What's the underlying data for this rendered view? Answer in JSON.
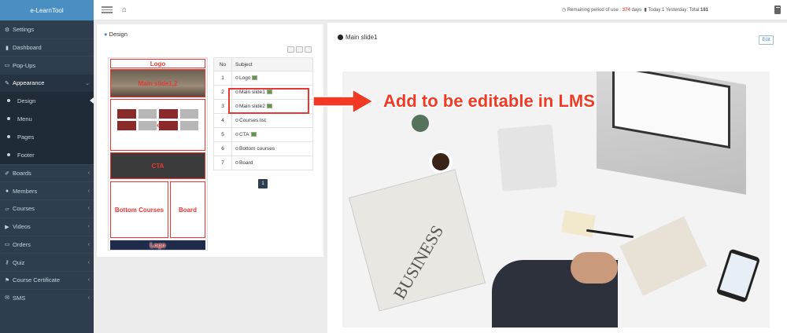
{
  "brand": "e-LearnTool",
  "sidebar": {
    "items": [
      {
        "label": "Settings",
        "icon": "gear-icon"
      },
      {
        "label": "Dashboard",
        "icon": "bar-chart-icon"
      },
      {
        "label": "Pop-Ups",
        "icon": "window-icon"
      },
      {
        "label": "Appearance",
        "icon": "brush-icon"
      },
      {
        "label": "Boards",
        "icon": "pencil-icon"
      },
      {
        "label": "Members",
        "icon": "users-icon"
      },
      {
        "label": "Courses",
        "icon": "folder-icon"
      },
      {
        "label": "Videos",
        "icon": "video-icon"
      },
      {
        "label": "Orders",
        "icon": "card-icon"
      },
      {
        "label": "Quiz",
        "icon": "key-icon"
      },
      {
        "label": "Course Certificate",
        "icon": "certificate-icon"
      },
      {
        "label": "SMS",
        "icon": "envelope-icon"
      }
    ],
    "appearance_sub": [
      "Design",
      "Menu",
      "Pages",
      "Footer"
    ]
  },
  "header": {
    "remaining_label": "Remaining period of use :",
    "remaining_days": "374",
    "days_unit": "days",
    "today_label": "Today:1",
    "yesterday_label": "Yesterday:",
    "total_label": "Total:",
    "total_value": "181"
  },
  "design_panel": {
    "title": "Design",
    "preview_labels": {
      "logo": "Logo",
      "main_slide": "Main slide1,2",
      "courses_list": "Courses List",
      "cta": "CTA",
      "bottom_courses": "Bottom Courses",
      "board": "Board",
      "footer_logo": "Logo"
    },
    "table": {
      "headers": [
        "No",
        "Subject"
      ],
      "rows": [
        {
          "no": "1",
          "subject": "Logo"
        },
        {
          "no": "2",
          "subject": "Main slide1"
        },
        {
          "no": "3",
          "subject": "Main slide2"
        },
        {
          "no": "4",
          "subject": "Courses list"
        },
        {
          "no": "5",
          "subject": "CTA"
        },
        {
          "no": "6",
          "subject": "Bottom courses"
        },
        {
          "no": "7",
          "subject": "Board"
        }
      ]
    },
    "page_button": "1"
  },
  "annotation": "Add to be editable in LMS",
  "detail_panel": {
    "title": "Main slide1",
    "edit_label": "Edit",
    "news_word": "BUSINESS"
  },
  "colors": {
    "sidebar": "#2e3e4e",
    "brand": "#4a8fc2",
    "annotation": "#f03a24"
  }
}
